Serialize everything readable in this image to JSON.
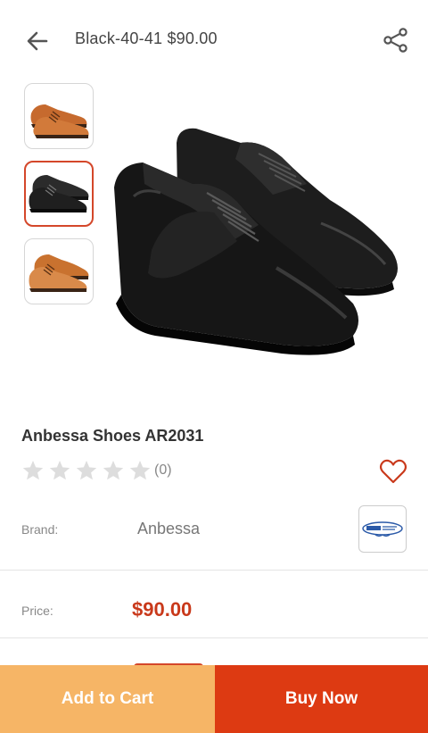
{
  "header": {
    "title": "Black-40-41 $90.00",
    "back_icon": "arrow-left-icon",
    "share_icon": "share-icon"
  },
  "gallery": {
    "thumbnails": [
      {
        "variant": "brown",
        "selected": false
      },
      {
        "variant": "black",
        "selected": true
      },
      {
        "variant": "brown",
        "selected": false
      }
    ],
    "main_variant": "black"
  },
  "product": {
    "name": "Anbessa Shoes AR2031",
    "rating": 0,
    "rating_count": "(0)",
    "brand_label": "Brand:",
    "brand_value": "Anbessa",
    "price_label": "Price:",
    "price_value": "$90.00"
  },
  "actions": {
    "add_to_cart": "Add to Cart",
    "buy_now": "Buy Now"
  },
  "colors": {
    "accent": "#dd3a12",
    "add_cart_bg": "#f6b566",
    "price": "#c9391b",
    "heart": "#c9391b",
    "star_empty": "#dddddd"
  }
}
